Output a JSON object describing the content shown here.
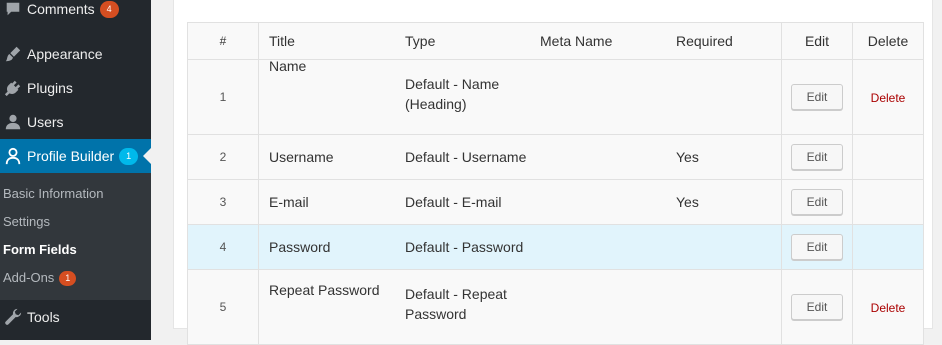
{
  "sidebar": {
    "items": [
      {
        "label": "Comments",
        "badge": "4",
        "icon": "comment-icon"
      },
      {
        "label": "Appearance",
        "icon": "paintbrush-icon"
      },
      {
        "label": "Plugins",
        "icon": "plugin-icon"
      },
      {
        "label": "Users",
        "icon": "user-icon"
      },
      {
        "label": "Profile Builder",
        "badge": "1",
        "icon": "profile-icon"
      },
      {
        "label": "Tools",
        "icon": "wrench-icon"
      }
    ],
    "submenu": [
      {
        "label": "Basic Information"
      },
      {
        "label": "Settings"
      },
      {
        "label": "Form Fields"
      },
      {
        "label": "Add-Ons",
        "badge": "1"
      }
    ]
  },
  "table": {
    "headers": {
      "num": "#",
      "title": "Title",
      "type": "Type",
      "meta": "Meta Name",
      "required": "Required",
      "edit": "Edit",
      "delete": "Delete"
    },
    "rows": [
      {
        "num": "1",
        "title": "Name",
        "type_line1": "Default - Name",
        "type_line2": "(Heading)",
        "meta": "",
        "required": "",
        "edit": "Edit",
        "delete": "Delete"
      },
      {
        "num": "2",
        "title": "Username",
        "type_line1": "Default - Username",
        "type_line2": "",
        "meta": "",
        "required": "Yes",
        "edit": "Edit",
        "delete": ""
      },
      {
        "num": "3",
        "title": "E-mail",
        "type_line1": "Default - E-mail",
        "type_line2": "",
        "meta": "",
        "required": "Yes",
        "edit": "Edit",
        "delete": ""
      },
      {
        "num": "4",
        "title": "Password",
        "type_line1": "Default - Password",
        "type_line2": "",
        "meta": "",
        "required": "",
        "edit": "Edit",
        "delete": ""
      },
      {
        "num": "5",
        "title": "Repeat Password",
        "type_line1": "Default - Repeat",
        "type_line2": "Password",
        "meta": "",
        "required": "",
        "edit": "Edit",
        "delete": "Delete"
      }
    ]
  },
  "colors": {
    "sidebar_bg": "#23282d",
    "active_bg": "#0073aa",
    "highlight_row": "#e1f4fc",
    "delete_link": "#aa0000"
  }
}
